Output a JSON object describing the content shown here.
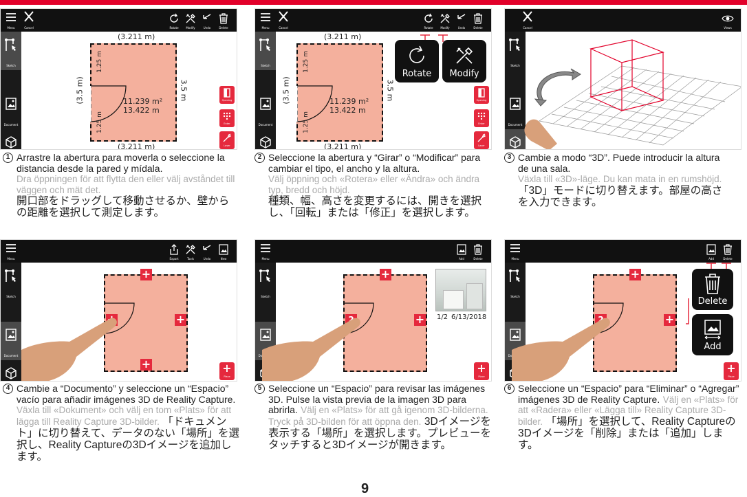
{
  "toolbar_labels": {
    "menu": "Menu",
    "cancel": "Cancel",
    "rotate": "Rotate",
    "modify": "Modify",
    "undo": "Undo",
    "delete": "Delete",
    "views": "Views",
    "export": "Export",
    "tools": "Tools",
    "new": "New",
    "add": "Add"
  },
  "sidebar_labels": {
    "sketch": "Sketch",
    "document": "Document",
    "threeD": "3D"
  },
  "side_buttons": {
    "opening": "Opening",
    "enter": "Enter",
    "laser": "Laser",
    "place": "Place"
  },
  "room": {
    "width_top": "(3.211 m)",
    "width_bottom": "(3.211 m)",
    "height_left": "(3.5 m)",
    "height_right": "3.5 m",
    "seg_top": "1.25 m",
    "seg_bottom": "1.25 m",
    "area": "11.239 m²",
    "perimeter": "13.422 m"
  },
  "popups": {
    "rotate": "Rotate",
    "modify": "Modify",
    "delete": "Delete",
    "add": "Add"
  },
  "space_label": "2",
  "preview": {
    "counter": "1/2",
    "date": "6/13/2018"
  },
  "captions": [
    {
      "num": "1",
      "es": "Arrastre la abertura para moverla o seleccione la distancia desde la pared y mídala.",
      "sv": "Dra öppningen för att flytta den eller välj avståndet till väggen och mät det.",
      "jp": "開口部をドラッグして移動させるか、壁からの距離を選択して測定します。"
    },
    {
      "num": "2",
      "es": "Seleccione la abertura y “Girar” o “Modificar” para cambiar el tipo, el ancho y la altura.",
      "sv": "Välj öppning och «Rotera» eller «Ändra» och ändra typ, bredd och höjd.",
      "jp": "種類、幅、高さを変更するには、開きを選択し、「回転」または「修正」を選択します。"
    },
    {
      "num": "3",
      "es": "Cambie a modo “3D”. Puede introducir la altura de una sala.",
      "sv": "Växla till «3D»-läge. Du kan mata in en rumshöjd.",
      "jp": "「3D」モードに切り替えます。部屋の高さを入力できます。"
    },
    {
      "num": "4",
      "es": "Cambie a “Documento” y seleccione un “Espacio” vacío para añadir imágenes 3D de Reality Capture.",
      "sv": "Växla till «Dokument» och välj en tom «Plats» för att lägga till Reality Capture 3D-bilder.",
      "jp": "「ドキュメント」に切り替えて、データのない「場所」を選択し、Reality Captureの3Dイメージを追加します。"
    },
    {
      "num": "5",
      "es": "Seleccione un “Espacio” para revisar las imágenes 3D. Pulse la vista previa de la imagen 3D para abrirla.",
      "sv": "Välj en «Plats» för att gå igenom 3D-bilderna. Tryck på 3D-bilden för att öppna den.",
      "jp": "3Dイメージを表示する「場所」を選択します。プレビューをタッチすると3Dイメージが開きます。"
    },
    {
      "num": "6",
      "es": "Seleccione un “Espacio” para “Eliminar” o “Agregar” imágenes 3D de Reality Capture.",
      "sv": "Välj en «Plats» för att «Radera» eller «Lägga till» Reality Capture 3D-bilder.",
      "jp": "「場所」を選択して、Reality Captureの3Dイメージを「削除」または「追加」します。"
    }
  ],
  "page_number": "9",
  "colors": {
    "brand_red": "#e2002a",
    "room_fill": "#f4b09d",
    "button_red": "#e5293d",
    "app_black": "#111111"
  }
}
